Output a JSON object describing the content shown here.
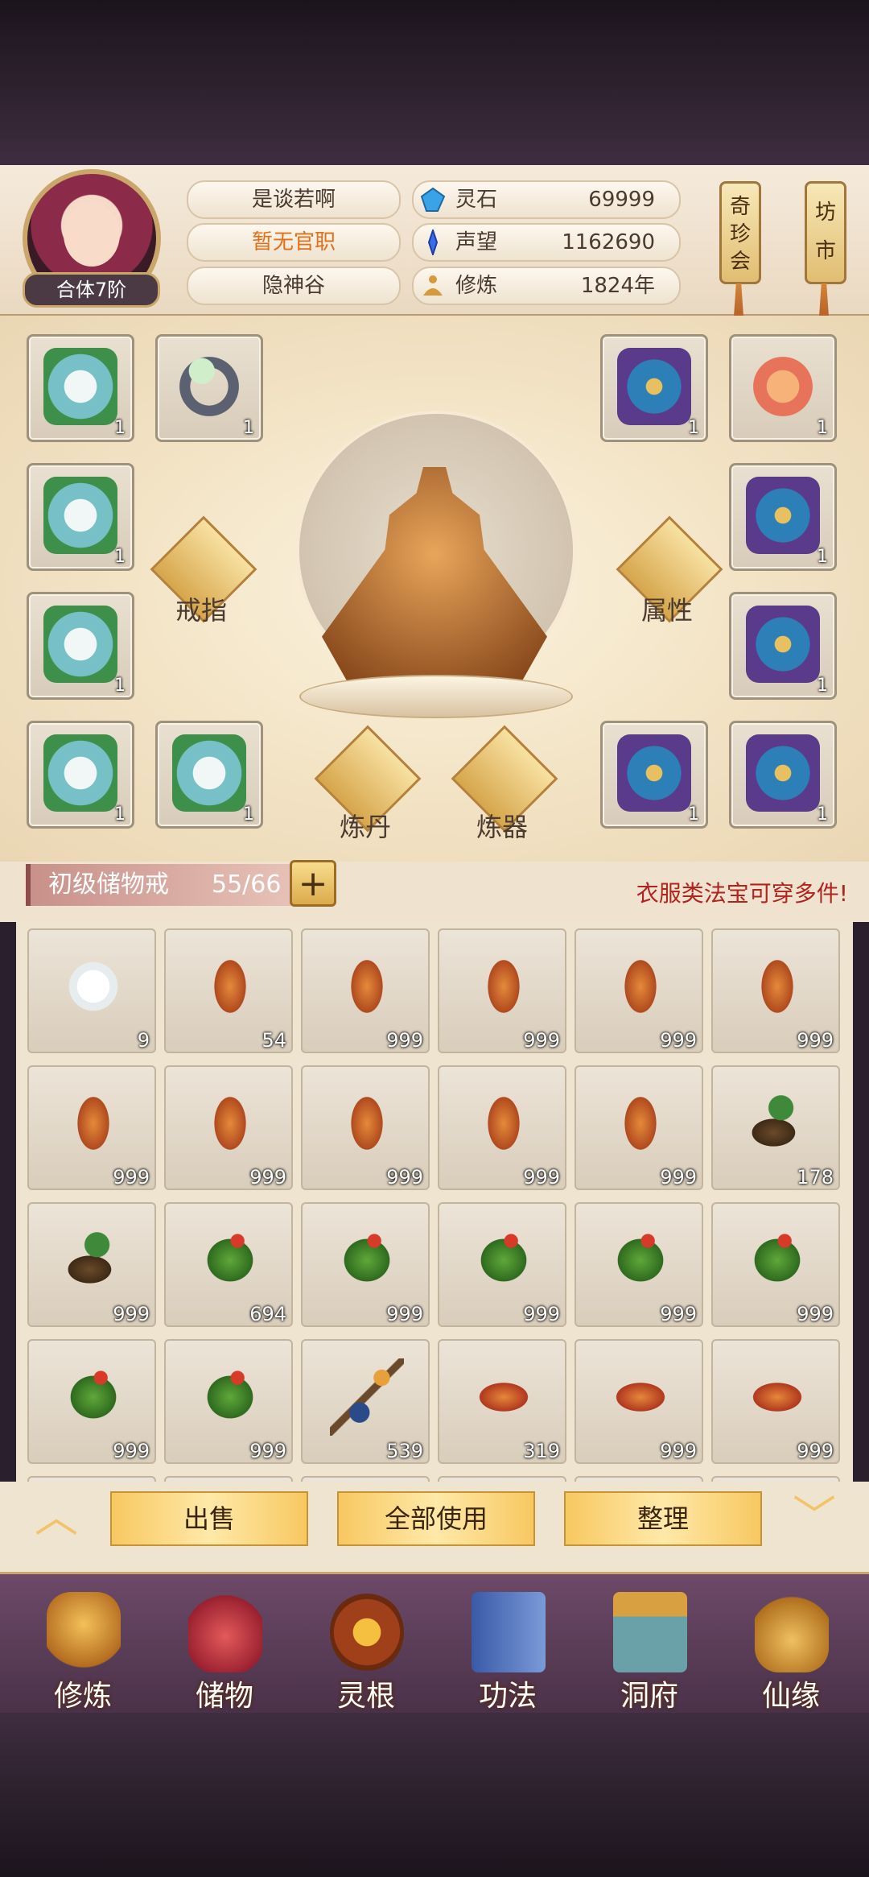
{
  "player": {
    "name": "是谈若啊",
    "official_post": "暂无官职",
    "sect": "隐神谷",
    "realm": "合体7阶"
  },
  "resources": [
    {
      "label": "灵石",
      "value": "69999",
      "icon": "spirit-stone-icon",
      "color": "#3aa3e8"
    },
    {
      "label": "声望",
      "value": "1162690",
      "icon": "prestige-icon",
      "color": "#3a6ee8"
    },
    {
      "label": "修炼",
      "value": "1824年",
      "icon": "cultivation-icon",
      "color": "#d79a3a"
    }
  ],
  "shops": [
    {
      "label": "奇珍会"
    },
    {
      "label": "坊市"
    }
  ],
  "equipment": {
    "left": [
      {
        "item": "cloth-armor",
        "count": "1"
      },
      {
        "item": "ring",
        "count": "1"
      },
      {
        "item": "cloth-armor",
        "count": "1"
      },
      {
        "item": "cloth-armor",
        "count": "1"
      },
      {
        "item": "cloth-armor",
        "count": "1"
      },
      {
        "item": "cloth-armor",
        "count": "1"
      }
    ],
    "right": [
      {
        "item": "winged-armor",
        "count": "1"
      },
      {
        "item": "dragon-pet",
        "count": "1"
      },
      {
        "item": "winged-armor",
        "count": "1"
      },
      {
        "item": "winged-armor",
        "count": "1"
      },
      {
        "item": "winged-armor",
        "count": "1"
      },
      {
        "item": "winged-armor",
        "count": "1"
      }
    ]
  },
  "functions": {
    "ring": "戒指",
    "attributes": "属性",
    "alchemy": "炼丹",
    "forging": "炼器"
  },
  "bag": {
    "name": "初级储物戒",
    "capacity": "55/66",
    "hint": "衣服类法宝可穿多件!"
  },
  "inventory": [
    {
      "item": "white-flower",
      "count": "9"
    },
    {
      "item": "ginseng",
      "count": "54"
    },
    {
      "item": "ginseng",
      "count": "999"
    },
    {
      "item": "ginseng",
      "count": "999"
    },
    {
      "item": "ginseng",
      "count": "999"
    },
    {
      "item": "ginseng",
      "count": "999"
    },
    {
      "item": "ginseng",
      "count": "999"
    },
    {
      "item": "ginseng",
      "count": "999"
    },
    {
      "item": "ginseng",
      "count": "999"
    },
    {
      "item": "ginseng",
      "count": "999"
    },
    {
      "item": "ginseng",
      "count": "999"
    },
    {
      "item": "root-seed",
      "count": "178"
    },
    {
      "item": "root-seed",
      "count": "999"
    },
    {
      "item": "flower-herb",
      "count": "694"
    },
    {
      "item": "flower-herb",
      "count": "999"
    },
    {
      "item": "flower-herb",
      "count": "999"
    },
    {
      "item": "flower-herb",
      "count": "999"
    },
    {
      "item": "flower-herb",
      "count": "999"
    },
    {
      "item": "flower-herb",
      "count": "999"
    },
    {
      "item": "flower-herb",
      "count": "999"
    },
    {
      "item": "berry-branch",
      "count": "539"
    },
    {
      "item": "cordyceps",
      "count": "319"
    },
    {
      "item": "cordyceps",
      "count": "999"
    },
    {
      "item": "cordyceps",
      "count": "999"
    }
  ],
  "actions": {
    "sell": "出售",
    "use_all": "全部使用",
    "organize": "整理"
  },
  "nav": [
    {
      "label": "修炼",
      "icon": "cultivate-icon"
    },
    {
      "label": "储物",
      "icon": "storage-bag-icon"
    },
    {
      "label": "灵根",
      "icon": "spirit-root-icon"
    },
    {
      "label": "功法",
      "icon": "technique-book-icon"
    },
    {
      "label": "洞府",
      "icon": "cave-mansion-icon"
    },
    {
      "label": "仙缘",
      "icon": "immortal-fate-icon"
    }
  ]
}
